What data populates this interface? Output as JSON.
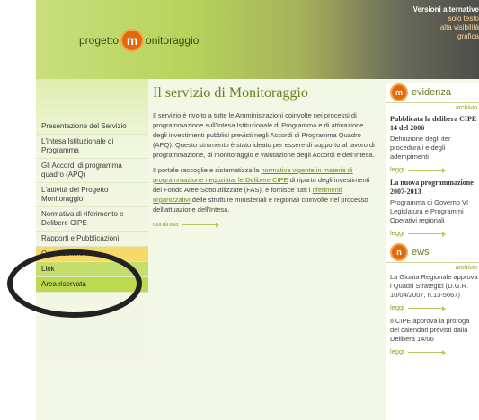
{
  "header": {
    "logo_left": "progetto",
    "logo_mark": "m",
    "logo_right": "onitoraggio",
    "alt_versions_title": "Versioni alternative",
    "alt_versions": [
      "solo testo",
      "alta visibilità",
      "grafica"
    ]
  },
  "sidebar": {
    "items": [
      {
        "label": "Presentazione del Servizio"
      },
      {
        "label": "L'intesa Istituzionale di Programma"
      },
      {
        "label": "Gli Accordi di programma quadro (APQ)"
      },
      {
        "label": "L'attività del Progetto Monitoraggio"
      },
      {
        "label": "Normativa di riferimento e Delibere CIPE"
      },
      {
        "label": "Rapporti e Pubblicazioni"
      },
      {
        "label": "Organizzazione"
      },
      {
        "label": "Link"
      },
      {
        "label": "Area riservata"
      }
    ]
  },
  "main": {
    "title": "Il servizio di Monitoraggio",
    "p1": "Il servizio è rivolto a tutte le Amministrazioni coinvolte nei processi di programmazione sull'Intesa Istituzionale di Programma e di attivazione degli investimenti pubblici previsti negli Accordi di Programma Quadro (APQ). Questo strumento è stato ideato per essere di supporto al lavoro di programmazione, di monitoraggio e valutazione degli Accordi e dell'Intesa.",
    "p2_a": "Il portale raccoglie e sistematizza la ",
    "p2_link1": "normativa vigente in materia di programmazione negoziata, le Delibere CIPE",
    "p2_b": " di riparto degli investimenti del Fondo Aree Sottoutilizzate (FAS), e fornisce tutti i ",
    "p2_link2": "riferimenti organizzativi",
    "p2_c": " delle strutture ministeriali e regionali coinvolte nel processo dell'attuazione dell'Intesa.",
    "continua": "continua"
  },
  "evidenza": {
    "heading": "evidenza",
    "archivio": "archivio",
    "items": [
      {
        "title": "Pubblicata la delibera CIPE 14 del 2006",
        "text": "Definizione degli iter procedurali e degli adempimenti",
        "leggi": "leggi"
      },
      {
        "title": "La nuova programmazione 2007-2013",
        "text": "Programma di Governo VI Legislatura e Programmi Operativi regionali",
        "leggi": "leggi"
      }
    ]
  },
  "news": {
    "heading": "ews",
    "archivio": "archivio",
    "items": [
      {
        "text": "La Giunta Regionale approva i Quadri Strategici (D.G.R. 10/04/2007, n.13-5667)",
        "leggi": "leggi"
      },
      {
        "text": "Il CIPE approva la proroga dei calendari previsti dalla Delibera 14/06",
        "leggi": "leggi"
      }
    ]
  }
}
